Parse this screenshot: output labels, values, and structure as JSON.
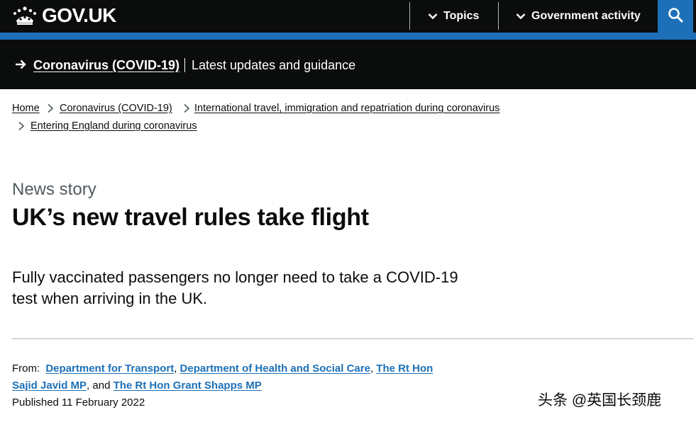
{
  "header": {
    "logo_text": "GOV.UK",
    "nav": [
      {
        "label": "Topics"
      },
      {
        "label": "Government activity"
      }
    ],
    "search_icon": "search-icon"
  },
  "covid_banner": {
    "link": "Coronavirus (COVID-19)",
    "text": "Latest updates and guidance"
  },
  "breadcrumbs": [
    "Home",
    "Coronavirus (COVID-19)",
    "International travel, immigration and repatriation during coronavirus",
    "Entering England during coronavirus"
  ],
  "article": {
    "doc_type": "News story",
    "title": "UK’s new travel rules take flight",
    "lead": "Fully vaccinated passengers no longer need to take a COVID-19 test when arriving in the UK."
  },
  "metadata": {
    "from_label": "From:",
    "orgs": [
      "Department for Transport",
      "Department of Health and Social Care",
      "The Rt Hon Sajid Javid MP",
      "The Rt Hon Grant Shapps MP"
    ],
    "separator_comma": ",",
    "separator_and": ", and",
    "published_label": "Published",
    "published_date": "11 February 2022"
  },
  "watermark": "头条 @英国长颈鹿",
  "colors": {
    "header_bg": "#0b0c0c",
    "link_blue": "#1d70b8",
    "secondary_text": "#505a5f",
    "rule": "#b1b4b6"
  }
}
